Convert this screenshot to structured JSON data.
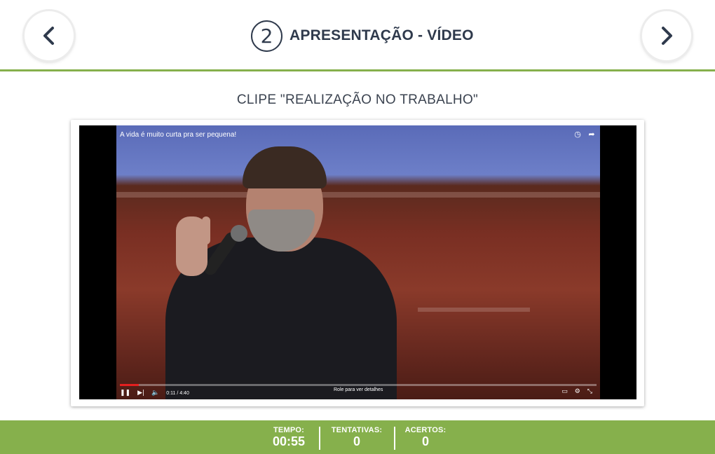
{
  "header": {
    "step_number": "2",
    "title": "APRESENTAÇÃO - VÍDEO",
    "prev_icon": "chevron-left-icon",
    "next_icon": "chevron-right-icon"
  },
  "content": {
    "subtitle": "CLIPE \"REALIZAÇÃO NO TRABALHO\"",
    "video": {
      "title": "A vida é muito curta pra ser pequena!",
      "time": "0:11 / 4:40",
      "scroll_hint": "Role para ver detalhes",
      "progress_fraction": 0.04
    }
  },
  "footer": {
    "tempo_label": "TEMPO:",
    "tempo_value": "00:55",
    "tentativas_label": "TENTATIVAS:",
    "tentativas_value": "0",
    "acertos_label": "ACERTOS:",
    "acertos_value": "0"
  },
  "colors": {
    "accent_green": "#86b04c",
    "title_text": "#2f3a4c"
  }
}
